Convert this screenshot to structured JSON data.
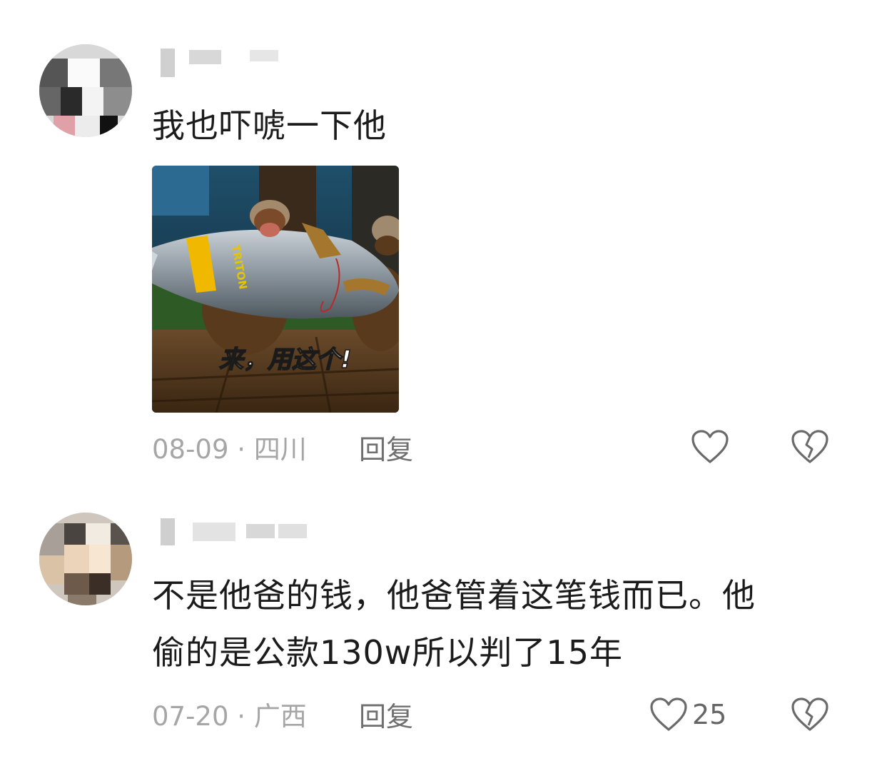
{
  "comments": [
    {
      "text": "我也吓唬一下他",
      "sticker_caption": "来，用这个!",
      "sticker_missile_text": "TRITON",
      "date": "08-09",
      "location": "四川",
      "reply_label": "回复",
      "like_count": ""
    },
    {
      "text_line1": "不是他爸的钱，他爸管着这笔钱而已。他",
      "text_line2": "偷的是公款130w所以判了15年",
      "date": "07-20",
      "location": "广西",
      "reply_label": "回复",
      "like_count": "25"
    }
  ],
  "separator": " · ",
  "icons": {
    "like": "heart-icon",
    "dislike": "broken-heart-icon"
  },
  "colors": {
    "text": "#1b1b1b",
    "meta": "#a6a6a6",
    "icon": "#6a6a6a"
  }
}
